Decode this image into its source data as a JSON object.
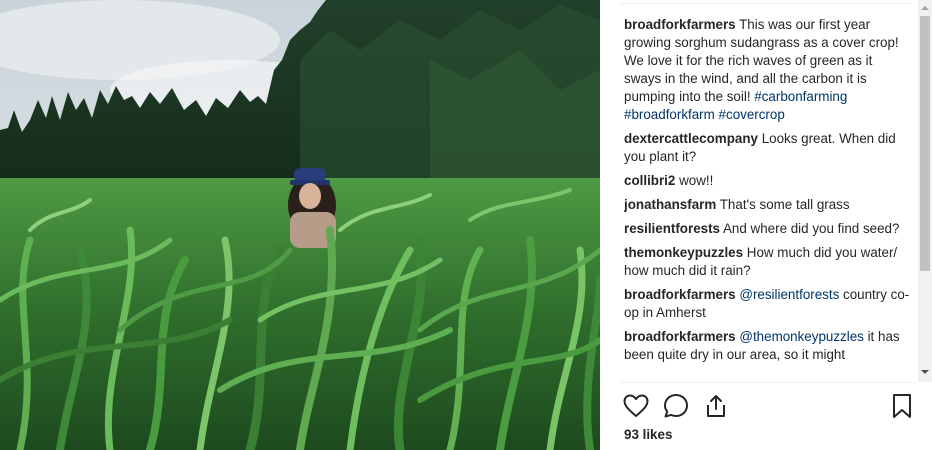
{
  "post": {
    "caption": {
      "user": "broadforkfarmers",
      "text": " This was our first year growing sorghum sudangrass as a cover crop! We love it for the rich waves of green as it sways in the wind, and all the carbon it is pumping into the soil! ",
      "tag1": "#carbonfarming",
      "tag2": "#broadforkfarm",
      "tag3": "#covercrop"
    },
    "comments": [
      {
        "user": "dextercattlecompany",
        "text": " Looks great. When did you plant it?"
      },
      {
        "user": "collibri2",
        "text": " wow!!"
      },
      {
        "user": "jonathansfarm",
        "text": " That's some tall grass"
      },
      {
        "user": "resilientforests",
        "text": " And where did you find seed?"
      },
      {
        "user": "themonkeypuzzles",
        "text": " How much did you water/ how much did it rain?"
      }
    ],
    "replies": [
      {
        "user": "broadforkfarmers",
        "mention": "@resilientforests",
        "text": " country co-op in Amherst"
      },
      {
        "user": "broadforkfarmers",
        "mention": "@themonkeypuzzles",
        "text": " it has been quite dry in our area, so it might"
      }
    ],
    "likes": "93 likes"
  },
  "icons": {
    "like": "heart-icon",
    "comment": "comment-icon",
    "share": "share-icon",
    "save": "bookmark-icon"
  },
  "colors": {
    "text": "#262626",
    "link": "#003569",
    "sky": "#dfe6ea",
    "forest": "#1f3a24",
    "crop": "#3f8a3a"
  }
}
